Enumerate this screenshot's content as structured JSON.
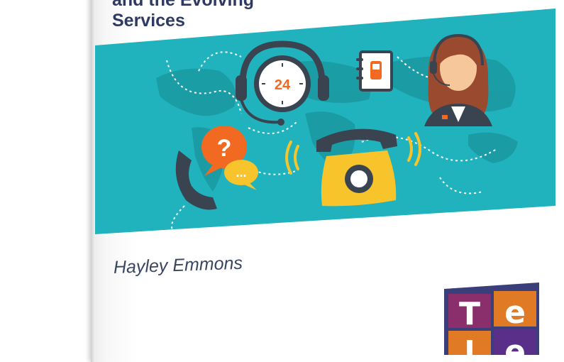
{
  "title_lines": "and the Evolving\nServices",
  "author": "Hayley Emmons",
  "clock_label": "24",
  "question_mark": "?",
  "chat_dots": "...",
  "logo": {
    "letters": [
      "T",
      "e",
      "l",
      "e"
    ]
  },
  "colors": {
    "banner": "#20b3bd",
    "title": "#2f3a63",
    "accent_orange": "#f26a22",
    "accent_yellow": "#f7c42b",
    "phone_dark": "#3a4350"
  },
  "icons": [
    "headset-icon",
    "clock-icon",
    "phone-book-icon",
    "agent-avatar-icon",
    "question-bubble-icon",
    "chat-bubble-icon",
    "handset-icon",
    "telephone-icon",
    "world-map"
  ]
}
